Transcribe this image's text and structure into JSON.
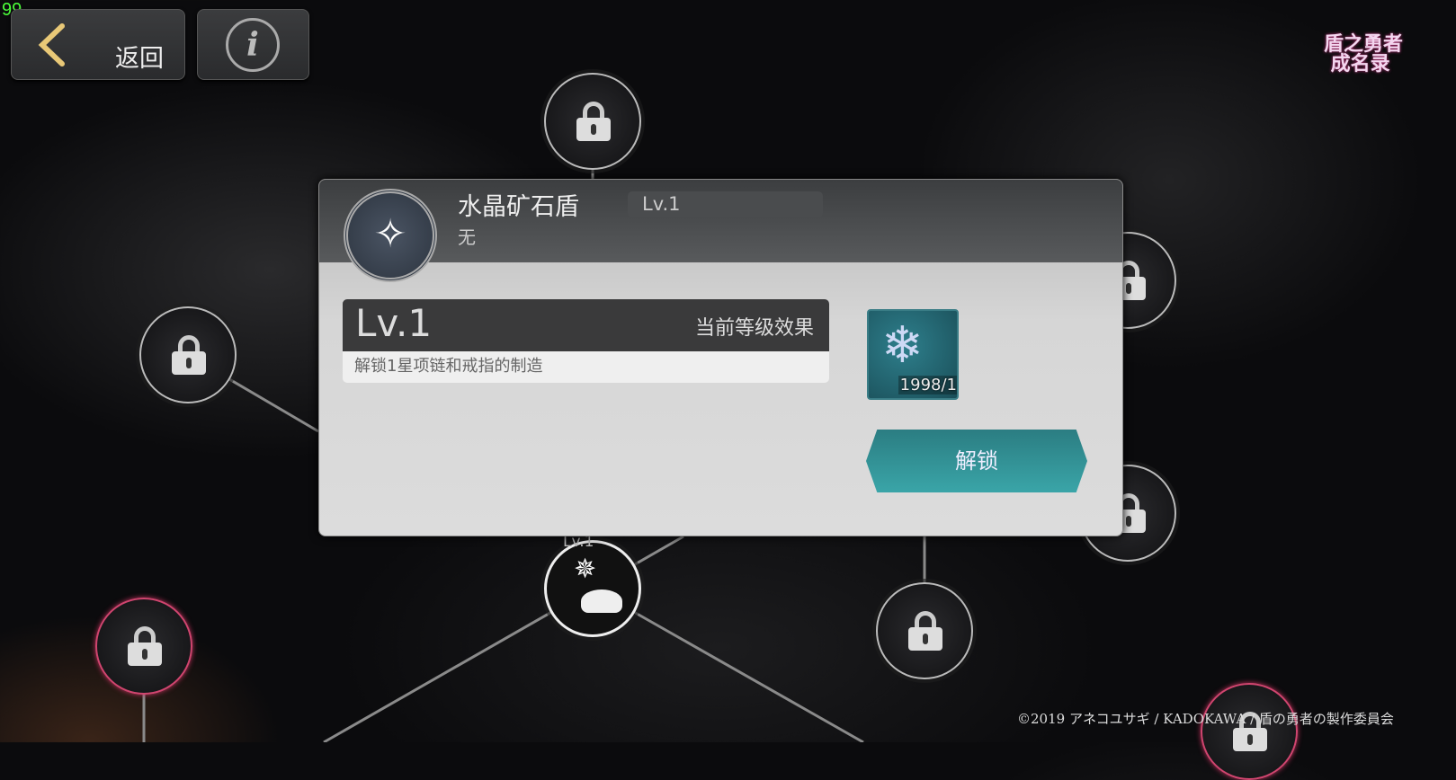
{
  "fps_counter": "99",
  "toolbar": {
    "back_label": "返回",
    "back_icon": "chevron-left-icon",
    "info_icon": "info-icon"
  },
  "logo": {
    "text": "盾之勇者成名录",
    "color": "#c0307a"
  },
  "skill_tree": {
    "active_node": {
      "level_label": "Lv.1",
      "icon": "compass-meat-icon"
    },
    "locked_node_icon": "lock-chain-icon",
    "locked_count": 7
  },
  "panel": {
    "title": "水晶矿石盾",
    "level": "Lv.1",
    "subtitle": "无",
    "effect": {
      "level": "Lv.1",
      "header": "当前等级效果",
      "description": "解锁1星项链和戒指的制造"
    },
    "cost_item": {
      "icon": "crystal-ore-icon",
      "count": "1998/1"
    },
    "unlock_label": "解锁",
    "accent_color": "#3aa5a8"
  },
  "copyright": "©2019 アネコユサギ / KADOKAWA / 盾の勇者の製作委員会"
}
